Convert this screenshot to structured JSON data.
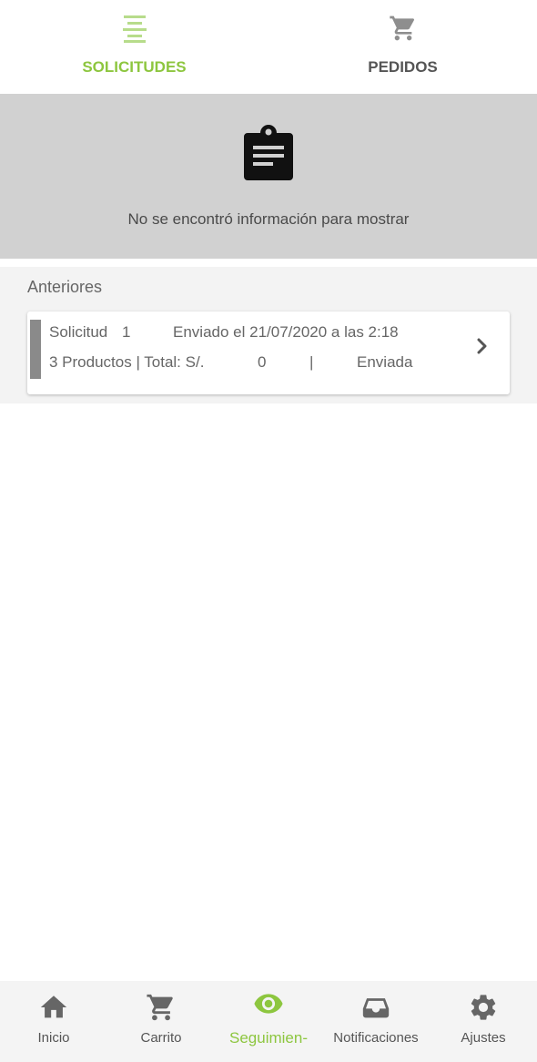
{
  "top_tabs": {
    "solicitudes": {
      "label": "SOLICITUDES",
      "icon": "list-lines-icon",
      "active": true
    },
    "pedidos": {
      "label": "PEDIDOS",
      "icon": "cart-icon",
      "active": false
    }
  },
  "empty_state": {
    "icon": "clipboard-icon",
    "message": "No se encontró información para mostrar"
  },
  "previous": {
    "title": "Anteriores",
    "items": [
      {
        "solicitud_label": "Solicitud",
        "solicitud_number": "1",
        "sent": "Enviado el 21/07/2020 a las 2:18",
        "products": "3 Productos | Total: S/.",
        "total": "0",
        "separator": "|",
        "status": "Enviada"
      }
    ]
  },
  "bottom_nav": {
    "items": [
      {
        "label": "Inicio",
        "icon": "home-icon"
      },
      {
        "label": "Carrito",
        "icon": "cart-icon"
      },
      {
        "label": "Seguimien-",
        "icon": "eye-icon",
        "active": true
      },
      {
        "label": "Notificaciones",
        "icon": "inbox-icon"
      },
      {
        "label": "Ajustes",
        "icon": "gear-icon"
      }
    ]
  },
  "colors": {
    "accent": "#8dc63f",
    "empty_bg": "#d1d1d1",
    "section_bg": "#f3f3f3",
    "status_bar": "#8a8a8a"
  }
}
